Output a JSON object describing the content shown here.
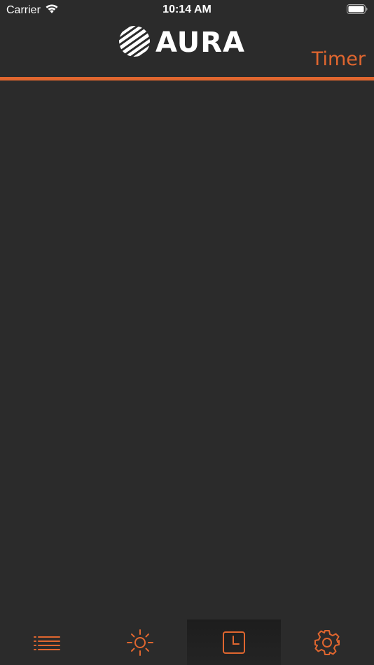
{
  "status_bar": {
    "carrier": "Carrier",
    "time": "10:14 AM",
    "wifi_icon": "wifi-icon",
    "battery_icon": "battery-icon"
  },
  "header": {
    "logo_text": "AURA",
    "title": "Timer",
    "accent_color": "#e0662f",
    "background_color": "#2b2b2b"
  },
  "tab_bar": {
    "tabs": [
      {
        "icon": "list-icon",
        "active": false
      },
      {
        "icon": "sun-icon",
        "active": false
      },
      {
        "icon": "clock-icon",
        "active": true
      },
      {
        "icon": "gear-icon",
        "active": false
      }
    ]
  }
}
